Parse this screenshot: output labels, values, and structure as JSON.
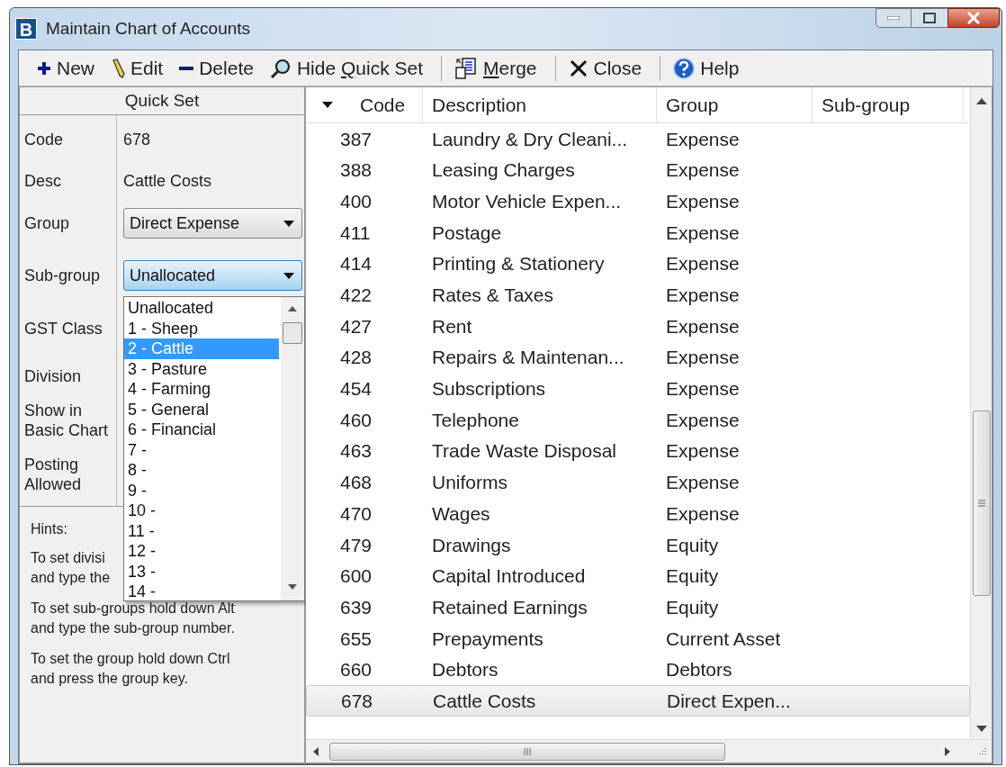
{
  "window": {
    "title": "Maintain Chart of Accounts",
    "app_letter": "B"
  },
  "toolbar": [
    {
      "kind": "new",
      "before": "New"
    },
    {
      "kind": "edit",
      "before": "Edit"
    },
    {
      "kind": "delete",
      "before": "Delete"
    },
    {
      "kind": "find",
      "before": "Hide ",
      "accel": "Q",
      "after": "uick Set"
    },
    {
      "kind": "merge",
      "accel": "M",
      "after": "erge"
    },
    {
      "kind": "close",
      "before": "Close"
    },
    {
      "kind": "help",
      "before": "Help"
    }
  ],
  "quick_set": {
    "title": "Quick Set",
    "fields": [
      {
        "label": "Code",
        "kind": "text",
        "value": "678"
      },
      {
        "label": "Desc",
        "kind": "text",
        "value": "Cattle Costs"
      },
      {
        "label": "Group",
        "kind": "select",
        "value": "Direct Expense",
        "focused": false
      },
      {
        "label": "Sub-group",
        "kind": "select",
        "value": "Unallocated",
        "focused": true
      },
      {
        "label": "GST Class",
        "kind": "empty"
      },
      {
        "label": "Division",
        "kind": "empty"
      },
      {
        "label": "Show in Basic Chart",
        "kind": "empty"
      },
      {
        "label": "Posting Allowed",
        "kind": "empty"
      }
    ],
    "hints_title": "Hints:",
    "hints": [
      [
        "To set divisi",
        "and type the"
      ],
      [
        "To set sub-groups hold down Alt",
        "and type the sub-group number."
      ],
      [
        "To set the group hold down Ctrl",
        "and press the group key."
      ]
    ],
    "dropdown": [
      {
        "label": "Unallocated",
        "selected": false
      },
      {
        "label": "1 - Sheep",
        "selected": false
      },
      {
        "label": "2 - Cattle",
        "selected": true
      },
      {
        "label": "3 - Pasture",
        "selected": false
      },
      {
        "label": "4 - Farming",
        "selected": false
      },
      {
        "label": "5 - General",
        "selected": false
      },
      {
        "label": "6 - Financial",
        "selected": false
      },
      {
        "label": "7 -",
        "selected": false
      },
      {
        "label": "8 -",
        "selected": false
      },
      {
        "label": "9 -",
        "selected": false
      },
      {
        "label": "10 -",
        "selected": false
      },
      {
        "label": "11 -",
        "selected": false
      },
      {
        "label": "12 -",
        "selected": false
      },
      {
        "label": "13 -",
        "selected": false
      },
      {
        "label": "14 -",
        "selected": false
      }
    ]
  },
  "table": {
    "columns": [
      "Code",
      "Description",
      "Group",
      "Sub-group"
    ],
    "rows": [
      {
        "code": "387",
        "description": "Laundry & Dry Cleani...",
        "group": "Expense",
        "selected": false
      },
      {
        "code": "388",
        "description": "Leasing Charges",
        "group": "Expense",
        "selected": false
      },
      {
        "code": "400",
        "description": "Motor Vehicle Expen...",
        "group": "Expense",
        "selected": false
      },
      {
        "code": "411",
        "description": "Postage",
        "group": "Expense",
        "selected": false
      },
      {
        "code": "414",
        "description": "Printing & Stationery",
        "group": "Expense",
        "selected": false
      },
      {
        "code": "422",
        "description": "Rates & Taxes",
        "group": "Expense",
        "selected": false
      },
      {
        "code": "427",
        "description": "Rent",
        "group": "Expense",
        "selected": false
      },
      {
        "code": "428",
        "description": "Repairs & Maintenan...",
        "group": "Expense",
        "selected": false
      },
      {
        "code": "454",
        "description": "Subscriptions",
        "group": "Expense",
        "selected": false
      },
      {
        "code": "460",
        "description": "Telephone",
        "group": "Expense",
        "selected": false
      },
      {
        "code": "463",
        "description": "Trade Waste Disposal",
        "group": "Expense",
        "selected": false
      },
      {
        "code": "468",
        "description": "Uniforms",
        "group": "Expense",
        "selected": false
      },
      {
        "code": "470",
        "description": "Wages",
        "group": "Expense",
        "selected": false
      },
      {
        "code": "479",
        "description": "Drawings",
        "group": "Equity",
        "selected": false
      },
      {
        "code": "600",
        "description": "Capital Introduced",
        "group": "Equity",
        "selected": false
      },
      {
        "code": "639",
        "description": "Retained Earnings",
        "group": "Equity",
        "selected": false
      },
      {
        "code": "655",
        "description": "Prepayments",
        "group": "Current Asset",
        "selected": false
      },
      {
        "code": "660",
        "description": "Debtors",
        "group": "Debtors",
        "selected": false
      },
      {
        "code": "678",
        "description": "Cattle Costs",
        "group": "Direct Expen...",
        "selected": true
      }
    ]
  }
}
